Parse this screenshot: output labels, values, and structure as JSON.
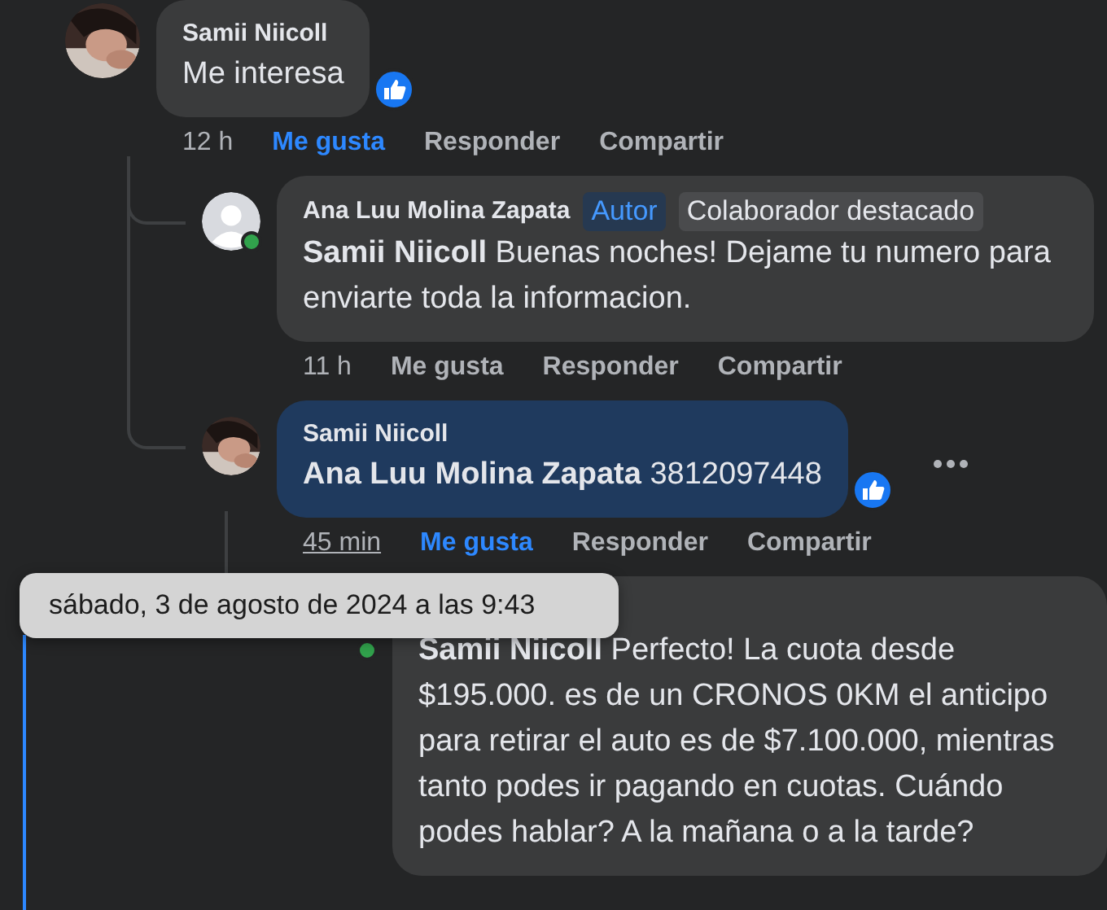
{
  "comments": [
    {
      "author": "Samii Niicoll",
      "text": "Me interesa",
      "reaction": true,
      "time": "12 h",
      "actions": [
        {
          "label": "Me gusta",
          "selected": true
        },
        {
          "label": "Responder",
          "selected": false
        },
        {
          "label": "Compartir",
          "selected": false
        }
      ],
      "children": [
        {
          "author": "Ana Luu Molina Zapata",
          "kind": "default",
          "online": true,
          "mention": "Samii Niicoll",
          "text": "Buenas noches! Dejame tu numero para enviarte toda la informacion.",
          "badges": [
            {
              "label": "Autor",
              "kind": "author"
            },
            {
              "label": "Colaborador destacado",
              "kind": "plain"
            }
          ],
          "time": "11 h",
          "actions": [
            {
              "label": "Me gusta",
              "selected": false
            },
            {
              "label": "Responder",
              "selected": false
            },
            {
              "label": "Compartir",
              "selected": false
            }
          ]
        },
        {
          "author": "Samii Niicoll",
          "mention": "Ana Luu Molina Zapata",
          "text": "3812097448",
          "highlighted": true,
          "reaction": true,
          "more": true,
          "time": "45 min",
          "time_underlined": true,
          "actions": [
            {
              "label": "Me gusta",
              "selected": true
            },
            {
              "label": "Responder",
              "selected": false
            },
            {
              "label": "Compartir",
              "selected": false
            }
          ],
          "children": [
            {
              "online": true,
              "mention": "Samii Niicoll",
              "text": "Perfecto! La cuota desde $195.000. es de un CRONOS 0KM el anticipo para retirar el auto es de $7.100.000, mientras tanto podes ir pagando en cuotas. Cuándo podes hablar? A la mañana o a la tarde?"
            }
          ]
        }
      ]
    }
  ],
  "tooltip": {
    "text": "sábado, 3 de agosto de 2024 a las 9:43"
  }
}
